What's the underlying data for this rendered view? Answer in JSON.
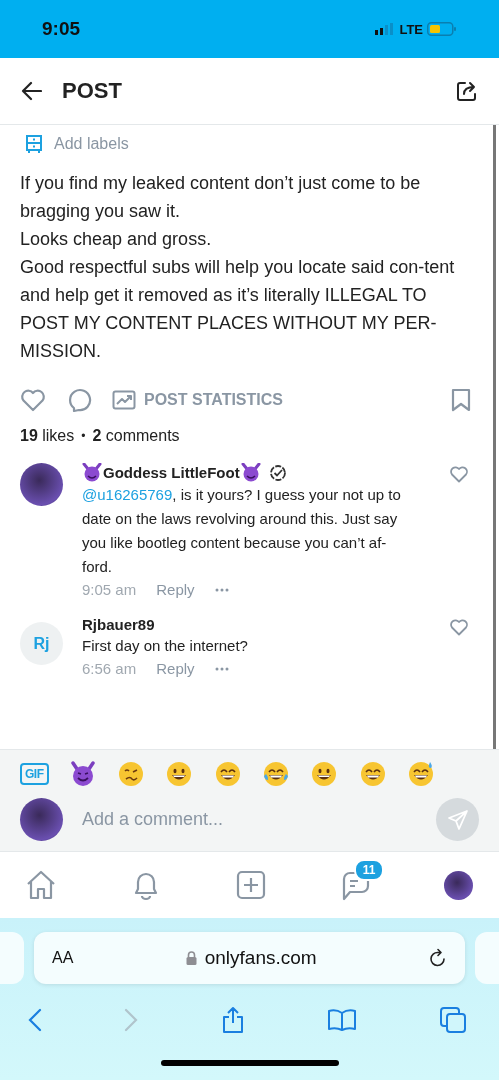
{
  "status_bar": {
    "time": "9:05",
    "network": "LTE"
  },
  "header": {
    "title": "POST"
  },
  "labels_button": "Add labels",
  "post": {
    "paragraphs": [
      "If you find my leaked content don’t just come to be bragging you saw it.",
      "Looks cheap and gross.",
      "Good respectful subs will help you locate said con-tent and help get it removed as it’s literally ILLEGAL TO POST MY CONTENT PLACES WITHOUT MY PER-MISSION."
    ]
  },
  "actions": {
    "statistics": "POST STATISTICS"
  },
  "counts": {
    "likes_count": "19",
    "likes_label": "likes",
    "separator": "•",
    "comments_count": "2",
    "comments_label": "comments"
  },
  "comments": [
    {
      "kind": "photo_avatar",
      "author": "Goddess LittleFoot",
      "devil_emojis": true,
      "verified": true,
      "mention": "@u16265769",
      "text": ", is it yours? I guess your not up to date on the laws revolving around this. Just say you like bootleg content because you can’t af-ford.",
      "time": "9:05 am",
      "reply": "Reply"
    },
    {
      "kind": "initials_avatar",
      "initials": "Rj",
      "author": "Rjbauer89",
      "devil_emojis": false,
      "verified": false,
      "text": "First day on the internet?",
      "time": "6:56 am",
      "reply": "Reply"
    }
  ],
  "emoji_bar": {
    "gif": "GIF",
    "emojis": [
      {
        "kind": "devil"
      },
      {
        "kind": "woozy"
      },
      {
        "kind": "grin"
      },
      {
        "kind": "beam"
      },
      {
        "kind": "joy"
      },
      {
        "kind": "smile"
      },
      {
        "kind": "beam"
      },
      {
        "kind": "sweat"
      }
    ]
  },
  "comment_input": {
    "placeholder": "Add a comment..."
  },
  "nav": {
    "messages_badge": "11"
  },
  "browser": {
    "text_size": "AA",
    "url": "onlyfans.com"
  }
}
